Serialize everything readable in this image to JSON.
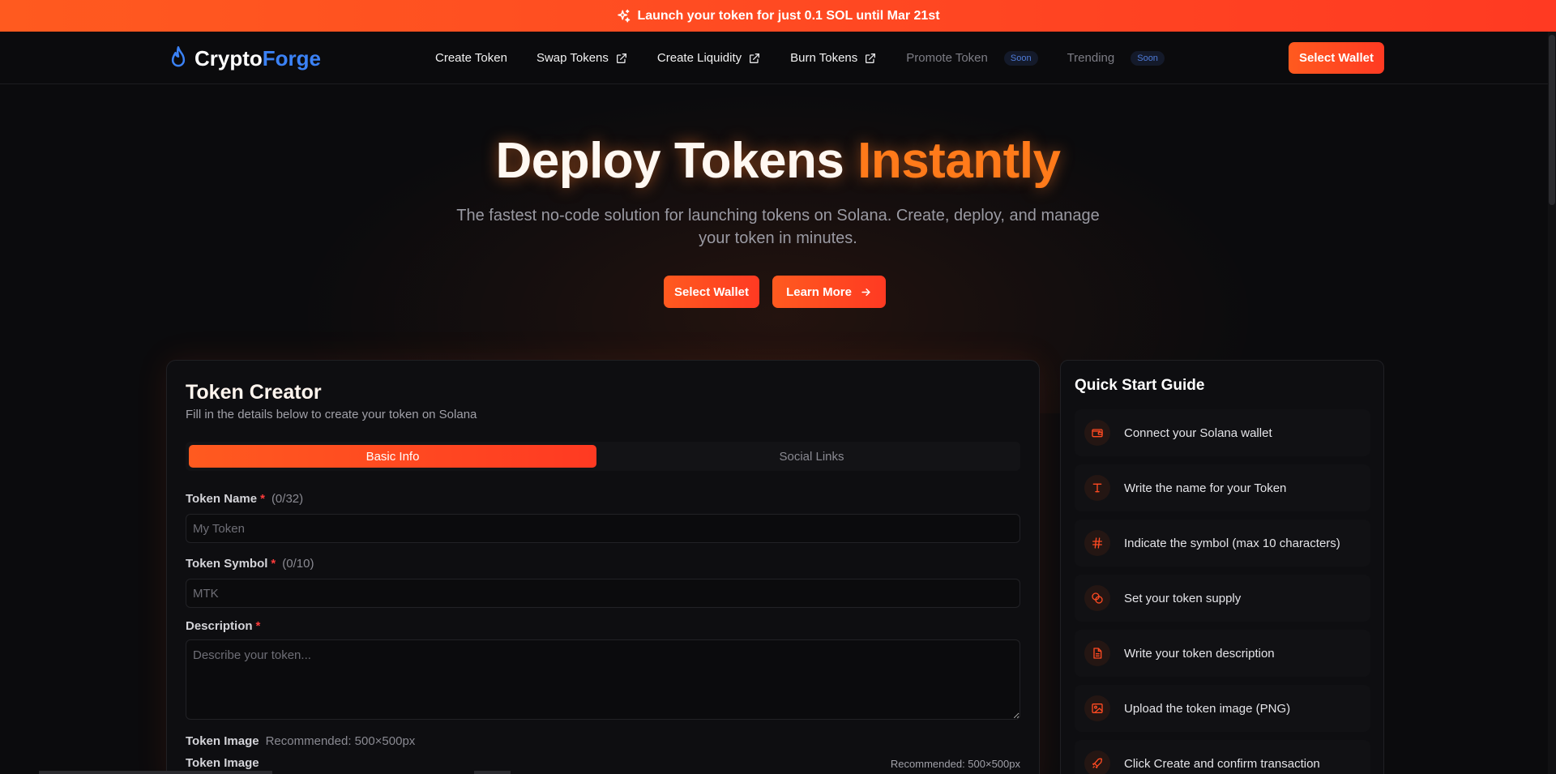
{
  "banner": {
    "text": "Launch your token for just 0.1 SOL until Mar 21st",
    "icon": "sparkles-icon"
  },
  "brand": {
    "part1": "Crypto",
    "part2": "Forge",
    "icon": "flame-icon",
    "accent": "#3b82f6"
  },
  "nav": {
    "items": [
      {
        "label": "Create Token",
        "external": false
      },
      {
        "label": "Swap Tokens",
        "external": true
      },
      {
        "label": "Create Liquidity",
        "external": true
      },
      {
        "label": "Burn Tokens",
        "external": true
      },
      {
        "label": "Promote Token",
        "badge": "Soon"
      },
      {
        "label": "Trending",
        "badge": "Soon"
      }
    ],
    "wallet_label": "Select Wallet"
  },
  "hero": {
    "title_part1": "Deploy Tokens",
    "title_part2": "Instantly",
    "subtitle": "The fastest no-code solution for launching tokens on Solana. Create, deploy, and manage your token in minutes.",
    "wallet_label": "Select Wallet",
    "learn_label": "Learn More"
  },
  "creator": {
    "title": "Token Creator",
    "subtitle": "Fill in the details below to create your token on Solana",
    "tabs": [
      {
        "label": "Basic Info",
        "active": true
      },
      {
        "label": "Social Links",
        "active": false
      }
    ],
    "name_label": "Token Name",
    "name_count": "(0/32)",
    "name_placeholder": "My Token",
    "symbol_label": "Token Symbol",
    "symbol_count": "(0/10)",
    "symbol_placeholder": "MTK",
    "desc_label": "Description",
    "desc_placeholder": "Describe your token...",
    "required_mark": "*",
    "image_label": "Token Image",
    "image_recommended": "Recommended: 500×500px",
    "image_label2": "Token Image",
    "image_recommended2": "Recommended: 500×500px"
  },
  "guide": {
    "title": "Quick Start Guide",
    "steps": [
      {
        "text": "Connect your Solana wallet",
        "icon": "wallet-icon"
      },
      {
        "text": "Write the name for your Token",
        "icon": "type-icon"
      },
      {
        "text": "Indicate the symbol (max 10 characters)",
        "icon": "hash-icon"
      },
      {
        "text": "Set your token supply",
        "icon": "coins-icon"
      },
      {
        "text": "Write your token description",
        "icon": "document-icon"
      },
      {
        "text": "Upload the token image (PNG)",
        "icon": "image-icon"
      },
      {
        "text": "Click Create and confirm transaction",
        "icon": "rocket-icon"
      }
    ]
  },
  "colors": {
    "accent_orange": "#ff5a1f",
    "accent_red": "#ff3a22",
    "title_orange": "#ff7a1a",
    "required_red": "#ff3b3b"
  }
}
